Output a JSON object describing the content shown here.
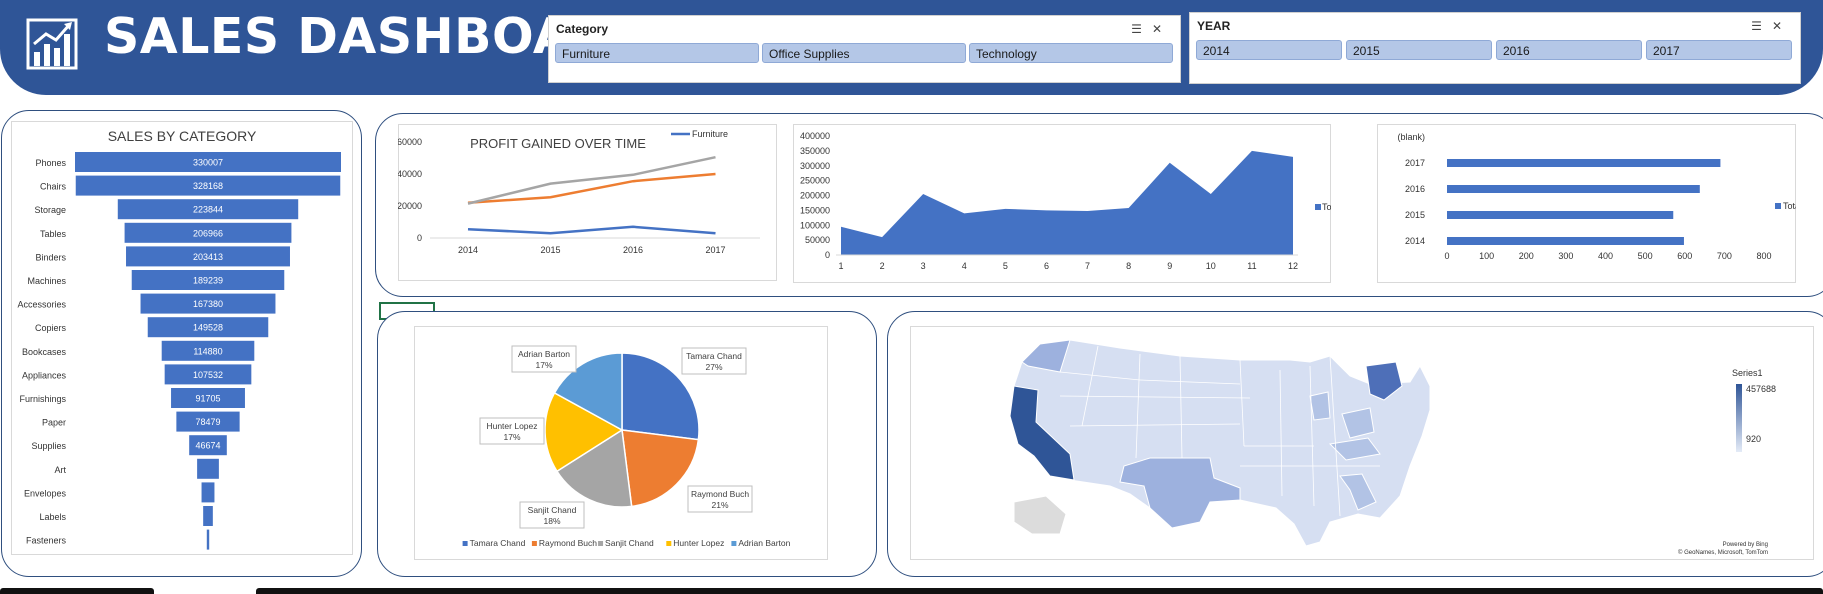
{
  "header": {
    "title": "SALES DASHBOARD",
    "logo_icon": "bar-chart-icon",
    "background_color": "#2f5597"
  },
  "slicers": {
    "category": {
      "title": "Category",
      "items": [
        "Furniture",
        "Office Supplies",
        "Technology"
      ]
    },
    "year": {
      "title": "YEAR",
      "items": [
        "2014",
        "2015",
        "2016",
        "2017"
      ]
    }
  },
  "chart_data": [
    {
      "id": "sales_by_category",
      "type": "bar",
      "orientation": "horizontal",
      "style": "funnel",
      "title": "SALES BY CATEGORY",
      "categories": [
        "Phones",
        "Chairs",
        "Storage",
        "Tables",
        "Binders",
        "Machines",
        "Accessories",
        "Copiers",
        "Bookcases",
        "Appliances",
        "Furnishings",
        "Paper",
        "Supplies",
        "Art",
        "Envelopes",
        "Labels",
        "Fasteners"
      ],
      "values": [
        330007,
        328168,
        223844,
        206966,
        203413,
        189239,
        167380,
        149528,
        114880,
        107532,
        91705,
        78479,
        46674,
        27000,
        16000,
        12000,
        3000
      ],
      "data_labels": [
        "330007",
        "328168",
        "223844",
        "206966",
        "203413",
        "189239",
        "167380",
        "149528",
        "114880",
        "107532",
        "91705",
        "78479",
        "46674",
        "",
        "",
        "",
        ""
      ],
      "color": "#4472c4"
    },
    {
      "id": "profit_over_time",
      "type": "line",
      "title": "PROFIT GAINED OVER TIME",
      "x": [
        "2014",
        "2015",
        "2016",
        "2017"
      ],
      "y_ticks": [
        "0",
        "20000",
        "40000",
        "60000"
      ],
      "ylim": [
        0,
        60000
      ],
      "legend": "top-right",
      "series": [
        {
          "name": "Furniture",
          "values": [
            5500,
            3000,
            7000,
            3000
          ],
          "color": "#4472c4"
        },
        {
          "values": [
            22000,
            25500,
            35500,
            40000
          ],
          "color": "#ed7d31"
        },
        {
          "values": [
            21500,
            34000,
            39500,
            50500
          ],
          "color": "#a5a5a5"
        }
      ]
    },
    {
      "id": "monthly_sales",
      "type": "area",
      "x": [
        "1",
        "2",
        "3",
        "4",
        "5",
        "6",
        "7",
        "8",
        "9",
        "10",
        "11",
        "12"
      ],
      "y_ticks": [
        "0",
        "50000",
        "100000",
        "150000",
        "200000",
        "250000",
        "300000",
        "350000",
        "400000"
      ],
      "ylim": [
        0,
        400000
      ],
      "legend": "right",
      "series": [
        {
          "name": "Total",
          "values": [
            95000,
            60000,
            205000,
            140000,
            155000,
            150000,
            148000,
            158000,
            310000,
            205000,
            350000,
            330000
          ],
          "color": "#4472c4"
        }
      ]
    },
    {
      "id": "orders_by_year",
      "type": "bar",
      "orientation": "horizontal",
      "categories": [
        "(blank)",
        "2017",
        "2016",
        "2015",
        "2014"
      ],
      "values": [
        0,
        690,
        638,
        571,
        598
      ],
      "x_ticks": [
        "0",
        "100",
        "200",
        "300",
        "400",
        "500",
        "600",
        "700",
        "800"
      ],
      "xlim": [
        0,
        800
      ],
      "legend": "right",
      "series_name": "Total",
      "color": "#4472c4"
    },
    {
      "id": "sales_by_person",
      "type": "pie",
      "slices": [
        {
          "label": "Tamara Chand",
          "percent": "27%",
          "value": 27,
          "color": "#4472c4"
        },
        {
          "label": "Raymond Buch",
          "percent": "21%",
          "value": 21,
          "color": "#ed7d31"
        },
        {
          "label": "Sanjit Chand",
          "percent": "18%",
          "value": 18,
          "color": "#a5a5a5"
        },
        {
          "label": "Hunter Lopez",
          "percent": "17%",
          "value": 17,
          "color": "#ffc000"
        },
        {
          "label": "Adrian Barton",
          "percent": "17%",
          "value": 17,
          "color": "#5b9bd5"
        }
      ],
      "legend": "bottom"
    },
    {
      "id": "sales_map",
      "type": "map",
      "legend_title": "Series1",
      "legend_max": "457688",
      "legend_min": "920",
      "attribution_1": "Powered by Bing",
      "attribution_2": "© GeoNames, Microsoft, TomTom",
      "scale_colors": [
        "#d6dff2",
        "#2f5597"
      ]
    }
  ]
}
